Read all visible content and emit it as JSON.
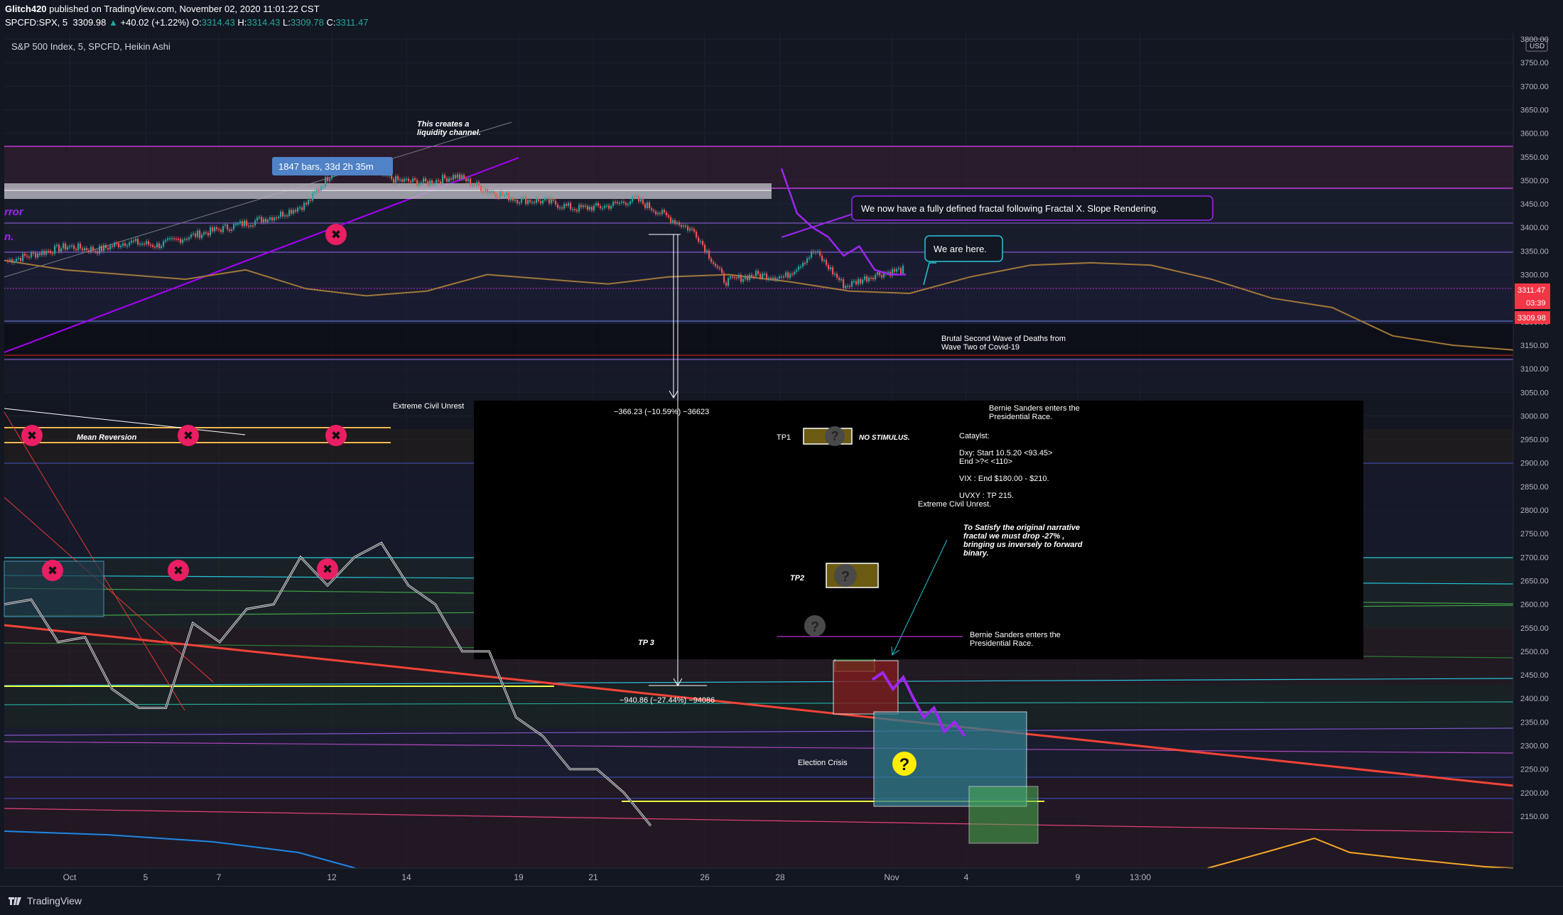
{
  "header": {
    "publisher": "Glitch420",
    "published_text": "published on TradingView.com, November 02, 2020 11:01:22 CST",
    "symbol": "SPCFD:SPX, 5",
    "price": "3309.98",
    "change": "+40.02 (+1.22%)",
    "o_label": "O:",
    "o_value": "3314.43",
    "h_label": "H:",
    "h_value": "3314.43",
    "l_label": "L:",
    "l_value": "3309.78",
    "c_label": "C:",
    "c_value": "3311.47"
  },
  "legend": {
    "title": "S&P 500 Index, 5, SPCFD, Heikin Ashi"
  },
  "footer": {
    "brand": "TradingView"
  },
  "colors": {
    "background": "#131722",
    "axis_text": "#b2b5be",
    "price_current": "#f23645",
    "fractal": "#9c27f0",
    "ha_up": "#26a69a",
    "ha_down": "#ef5350"
  },
  "chart_data": {
    "type": "line",
    "title": "S&P 500 Index, 5, SPCFD, Heikin Ashi",
    "currency": "USD",
    "ylim": [
      2120,
      3820
    ],
    "y_ticks": [
      "3800.00",
      "3750.00",
      "3700.00",
      "3650.00",
      "3600.00",
      "3550.00",
      "3500.00",
      "3450.00",
      "3400.00",
      "3350.00",
      "3300.00",
      "3250.00",
      "3200.00",
      "3150.00",
      "3100.00",
      "3050.00",
      "3000.00",
      "2950.00",
      "2900.00",
      "2850.00",
      "2800.00",
      "2750.00",
      "2700.00",
      "2650.00",
      "2600.00",
      "2550.00",
      "2500.00",
      "2450.00",
      "2400.00",
      "2350.00",
      "2300.00",
      "2250.00",
      "2200.00",
      "2150.00"
    ],
    "x_ticks": [
      "Oct",
      "5",
      "7",
      "12",
      "14",
      "19",
      "21",
      "26",
      "28",
      "Nov",
      "4",
      "9",
      "13:00"
    ],
    "price_labels": {
      "last": "3311.47",
      "countdown": "03:39",
      "current": "3309.98"
    },
    "price_series": {
      "name": "SPX 5m",
      "x": [
        "Oct",
        "",
        "",
        "",
        "",
        "5",
        "",
        "7",
        "",
        "",
        "12",
        "",
        "14",
        "",
        "",
        "19",
        "",
        "21",
        "",
        "",
        "26",
        "",
        "28",
        "",
        "",
        "Nov"
      ],
      "values": [
        3330,
        3345,
        3360,
        3352,
        3370,
        3362,
        3380,
        3395,
        3410,
        3425,
        3450,
        3530,
        3525,
        3500,
        3495,
        3510,
        3480,
        3460,
        3455,
        3440,
        3445,
        3460,
        3425,
        3390,
        3285,
        3300,
        3295,
        3350,
        3275,
        3300,
        3311
      ]
    },
    "fractal_projection": {
      "name": "Fractal X",
      "values": [
        3525,
        3430,
        3400,
        3380,
        3340,
        3360,
        3310,
        3300,
        3300
      ]
    },
    "brown_ma": [
      3330,
      3310,
      3300,
      3290,
      3310,
      3270,
      3255,
      3265,
      3300,
      3290,
      3280,
      3295,
      3300,
      3285,
      3265,
      3260,
      3295,
      3320,
      3325,
      3320,
      3290,
      3250,
      3230,
      3170,
      3150,
      3140
    ],
    "white_fractal": [
      2600,
      2610,
      2520,
      2530,
      2420,
      2380,
      2380,
      2560,
      2520,
      2590,
      2600,
      2700,
      2640,
      2700,
      2730,
      2640,
      2600,
      2500,
      2500,
      2360,
      2320,
      2250,
      2250,
      2200,
      2130
    ],
    "annotations": {
      "bars_range": "1847 bars, 33d 2h 35m",
      "liquidity": "This creates a liquidity channel.",
      "fractal_callout": "We now have a fully defined fractal following Fractal X. Slope Rendering.",
      "we_are_here": "We are here.",
      "second_wave_line1": "Brutal Second Wave of Deaths from",
      "second_wave_line2": "Wave Two of Covid-19",
      "civil_unrest_left": "Extreme Civil Unrest",
      "civil_unrest_right": "Extreme Civil Unrest.",
      "mean_reversion": "Mean Reversion",
      "measure_1": "−366.23 (−10.59%) −36623",
      "measure_2": "−940.86 (−27.44%) −94086",
      "tp1": "TP1",
      "no_stimulus": "NO STIMULUS.",
      "tp2": "TP2",
      "tp3": "TP 3",
      "bernie_top_1": "Bernie Sanders enters the",
      "bernie_top_2": "Presidential Race.",
      "catalyst": "Cataylst:",
      "dxy_1": "Dxy: Start 10.5.20 <93.45>",
      "dxy_2": "End >?< <110>",
      "vix": "VIX : End $180.00 - $210.",
      "uvxy": "UVXY : TP 215.",
      "satisfy_1": "To Satisfy the original narrative",
      "satisfy_2": "fractal we must drop -27% ,",
      "satisfy_3": "bringing us inversely to forward",
      "satisfy_4": "binary.",
      "bernie_bottom_1": "Bernie Sanders enters the",
      "bernie_bottom_2": "Presidential Race.",
      "election_crisis": "Election Crisis",
      "left_edge_1": "rror",
      "left_edge_2": "n."
    }
  }
}
